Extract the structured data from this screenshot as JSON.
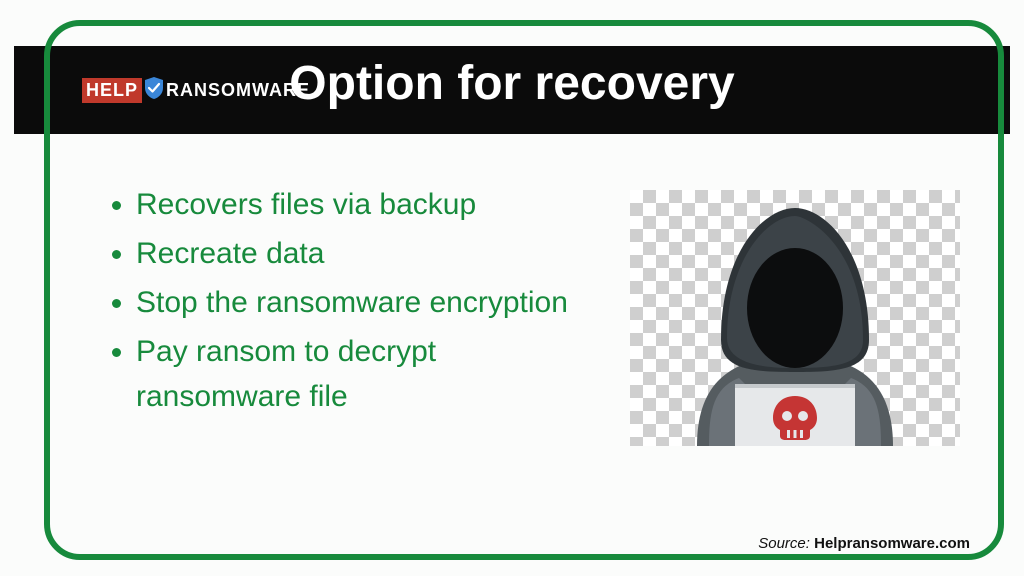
{
  "logo": {
    "help": "HELP",
    "ransomware": "RANSOMWARE"
  },
  "title": "Option for recovery",
  "bullets": [
    "Recovers files via backup",
    "Recreate data",
    "Stop the ransomware encryption",
    "Pay ransom to decrypt ransomware file"
  ],
  "source": {
    "label": "Source: ",
    "site": "Helpransomware.com"
  }
}
